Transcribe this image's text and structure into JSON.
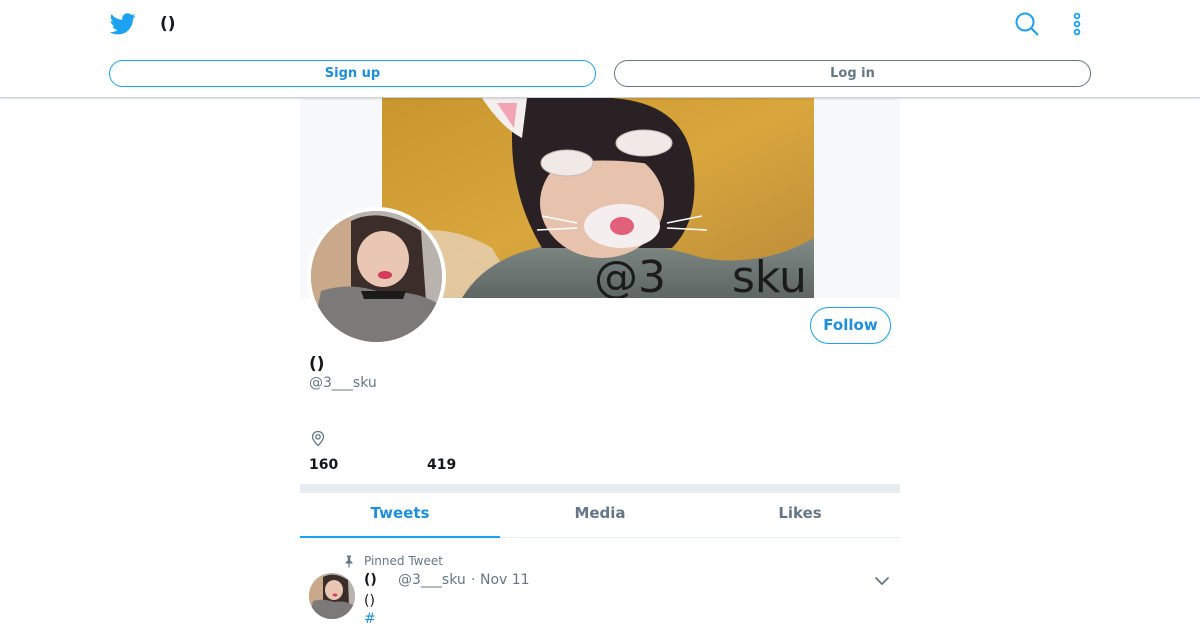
{
  "header": {
    "title": "()",
    "signup_label": "Sign up",
    "login_label": "Log in",
    "logo_icon": "twitter-bird-icon",
    "search_icon": "search-icon",
    "more_icon": "more-vertical-icon"
  },
  "profile": {
    "banner_overlay_text": "@3___sku",
    "name": "()",
    "handle": "@3___sku",
    "follow_label": "Follow",
    "location_icon": "location-pin-icon",
    "following_count": "160",
    "followers_count": "419"
  },
  "tabs": [
    {
      "label": "Tweets",
      "active": true
    },
    {
      "label": "Media",
      "active": false
    },
    {
      "label": "Likes",
      "active": false
    }
  ],
  "tweet": {
    "pinned_label": "Pinned Tweet",
    "name": "()",
    "handle": "@3___sku",
    "separator": "·",
    "date": "Nov 11",
    "text": "()",
    "hashtag": "#"
  },
  "colors": {
    "accent": "#1da1f2",
    "secondary_text": "#657786",
    "divider": "#e6ecf0"
  }
}
